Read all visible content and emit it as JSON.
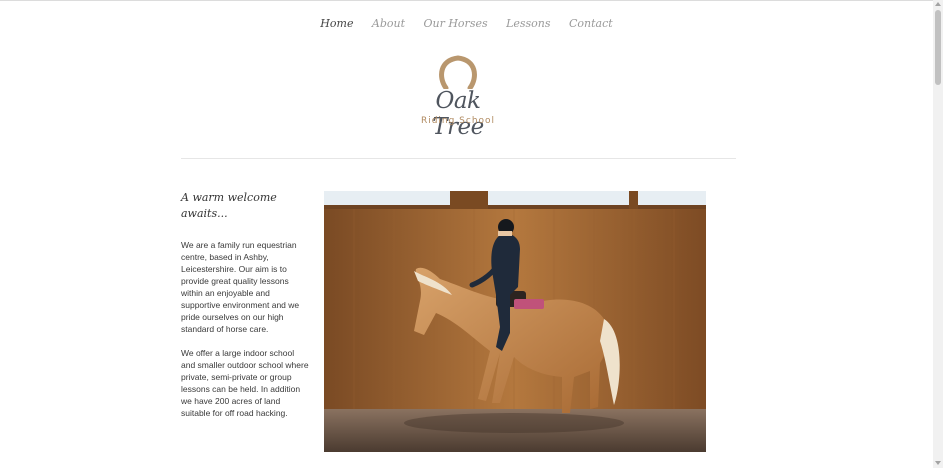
{
  "nav": {
    "items": [
      {
        "label": "Home",
        "active": true
      },
      {
        "label": "About",
        "active": false
      },
      {
        "label": "Our Horses",
        "active": false
      },
      {
        "label": "Lessons",
        "active": false
      },
      {
        "label": "Contact",
        "active": false
      }
    ]
  },
  "logo": {
    "title": "Oak Tree",
    "subtitle": "Riding School",
    "icon": "horseshoe-icon",
    "colors": {
      "horseshoe": "#b9976e",
      "title": "#4f555e",
      "subtitle": "#b08a60"
    }
  },
  "main": {
    "heading": "A warm welcome awaits...",
    "paragraphs": [
      "We are a family run equestrian centre, based in Ashby, Leicestershire. Our aim is to provide great quality lessons within an enjoyable and supportive environment and we pride ourselves on our high standard of horse care.",
      "We offer a large indoor school and smaller outdoor school where private, semi-private or group lessons can be held. In addition we have 200 acres of land suitable for off road hacking."
    ],
    "photo": "horse-and-rider-photo"
  }
}
